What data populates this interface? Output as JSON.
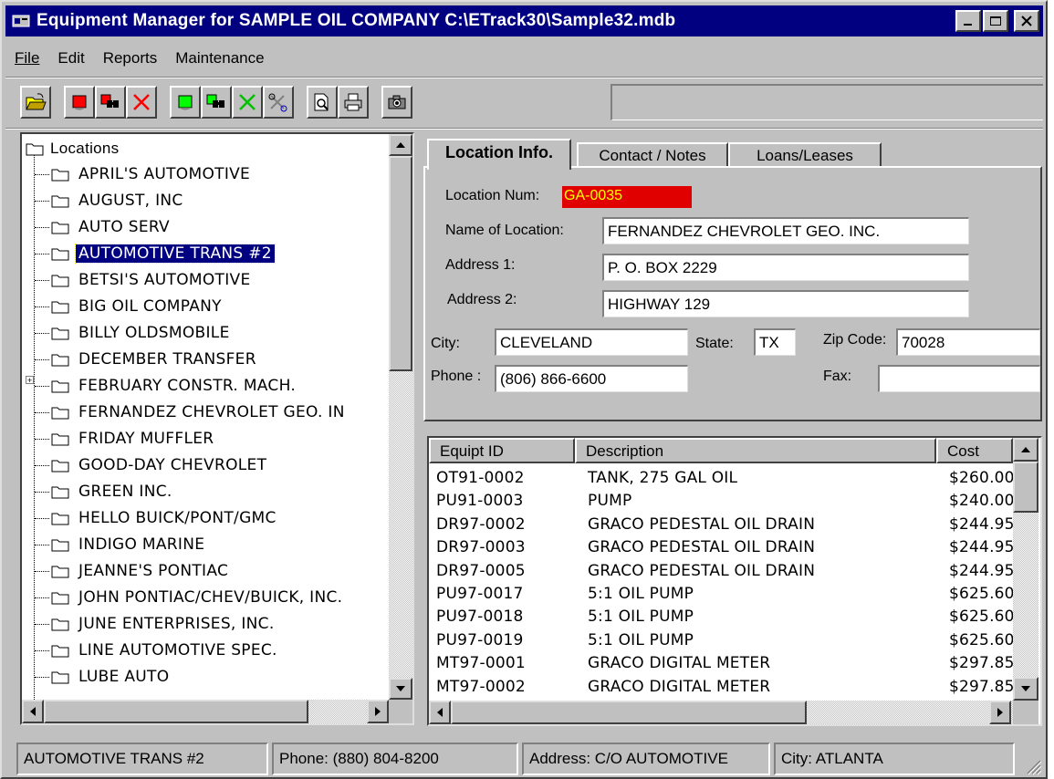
{
  "window": {
    "title": "Equipment Manager for SAMPLE OIL COMPANY  C:\\ETrack30\\Sample32.mdb",
    "icon": "app-icon"
  },
  "menu": {
    "file": "File",
    "edit": "Edit",
    "reports": "Reports",
    "maintenance": "Maintenance"
  },
  "toolbar": {
    "icons": [
      "open-folder-icon",
      "red-record-icon",
      "find-location-icon",
      "delete-location-icon",
      "green-record-icon",
      "find-equipment-icon",
      "delete-equipment-icon",
      "tools-icon",
      "print-preview-icon",
      "print-icon",
      "camera-icon"
    ]
  },
  "tree": {
    "root": "Locations",
    "items": [
      "APRIL'S AUTOMOTIVE",
      "AUGUST, INC",
      "AUTO SERV",
      "AUTOMOTIVE TRANS #2",
      "BETSI'S AUTOMOTIVE",
      "BIG OIL COMPANY",
      "BILLY OLDSMOBILE",
      "DECEMBER TRANSFER",
      "FEBRUARY CONSTR. MACH.",
      "FERNANDEZ CHEVROLET GEO. IN",
      "FRIDAY MUFFLER",
      "GOOD-DAY CHEVROLET",
      "GREEN INC.",
      "HELLO BUICK/PONT/GMC",
      "INDIGO MARINE",
      "JEANNE'S PONTIAC",
      "JOHN PONTIAC/CHEV/BUICK, INC.",
      "JUNE ENTERPRISES, INC.",
      "LINE AUTOMOTIVE SPEC.",
      "LUBE AUTO"
    ],
    "selected_index": 3
  },
  "tabs": {
    "location_info": "Location Info.",
    "contact_notes": "Contact / Notes",
    "loans_leases": "Loans/Leases"
  },
  "location": {
    "num_label": "Location Num:",
    "num_value": "GA-0035",
    "name_label": "Name of Location:",
    "name_value": "FERNANDEZ CHEVROLET GEO. INC.",
    "addr1_label": "Address 1:",
    "addr1_value": "P. O. BOX 2229",
    "addr2_label": "Address 2:",
    "addr2_value": "HIGHWAY 129",
    "city_label": "City:",
    "city_value": "CLEVELAND",
    "state_label": "State:",
    "state_value": "TX",
    "zip_label": "Zip Code:",
    "zip_value": "70028",
    "phone_label": "Phone :",
    "phone_value": "(806) 866-6600",
    "fax_label": "Fax:",
    "fax_value": ""
  },
  "equipment": {
    "columns": [
      "Equipt ID",
      "Description",
      "Cost"
    ],
    "rows": [
      [
        "OT91-0002",
        "TANK, 275 GAL OIL",
        "$260.00"
      ],
      [
        "PU91-0003",
        "PUMP",
        "$240.00"
      ],
      [
        "DR97-0002",
        "GRACO PEDESTAL OIL DRAIN",
        "$244.95"
      ],
      [
        "DR97-0003",
        "GRACO PEDESTAL OIL DRAIN",
        "$244.95"
      ],
      [
        "DR97-0005",
        "GRACO PEDESTAL OIL DRAIN",
        "$244.95"
      ],
      [
        "PU97-0017",
        "5:1 OIL PUMP",
        "$625.60"
      ],
      [
        "PU97-0018",
        "5:1 OIL PUMP",
        "$625.60"
      ],
      [
        "PU97-0019",
        "5:1 OIL PUMP",
        "$625.60"
      ],
      [
        "MT97-0001",
        "GRACO DIGITAL METER",
        "$297.85"
      ],
      [
        "MT97-0002",
        "GRACO DIGITAL METER",
        "$297.85"
      ]
    ]
  },
  "status": {
    "name": "AUTOMOTIVE TRANS #2",
    "phone": "Phone: (880) 804-8200",
    "address": "Address: C/O AUTOMOTIVE",
    "city": "City: ATLANTA"
  },
  "colors": {
    "title_bar": "#000080",
    "selection": "#000080",
    "location_num_bg": "#e00000",
    "location_num_fg": "#ffff00"
  }
}
